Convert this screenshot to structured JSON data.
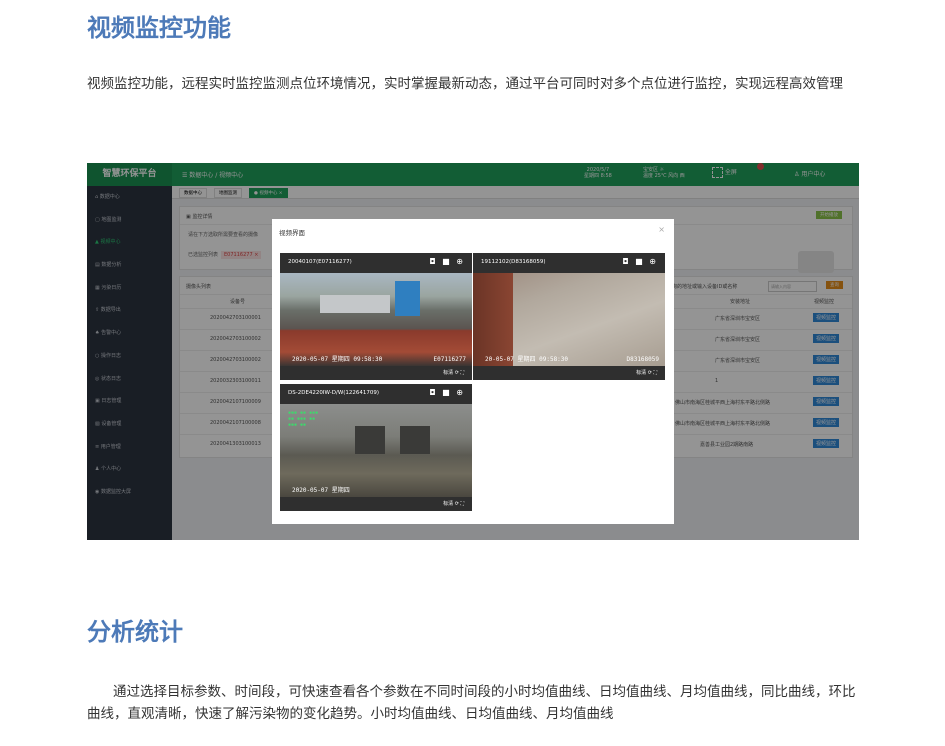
{
  "section1": {
    "title": "视频监控功能",
    "desc": "视频监控功能，远程实时监控监测点位环境情况，实时掌握最新动态，通过平台可同时对多个点位进行监控，实现远程高效管理"
  },
  "section2": {
    "title": "分析统计",
    "desc": "通过选择目标参数、时间段，可快速查看各个参数在不同时间段的小时均值曲线、日均值曲线、月均值曲线，同比曲线，环比曲线，直观清晰，快速了解污染物的变化趋势。小时均值曲线、日均值曲线、月均值曲线"
  },
  "app": {
    "brand": "智慧环保平台",
    "breadcrumb": "数据中心 / 视频中心",
    "date_line1": "2020/5/7",
    "date_line2": "星期四 8:58",
    "weather_line1": "宝安区 ☼",
    "weather_line2": "温度 25℃ 风向 西",
    "fullscreen": "全屏",
    "user": "用户中心",
    "sidebar": [
      {
        "label": "数据中心",
        "icon": "home-icon",
        "active": false
      },
      {
        "label": "地图监测",
        "icon": "map-icon",
        "active": false
      },
      {
        "label": "视频中心",
        "icon": "video-icon",
        "active": true
      },
      {
        "label": "数据分析",
        "icon": "chart-icon",
        "active": false
      },
      {
        "label": "污染日历",
        "icon": "calendar-icon",
        "active": false
      },
      {
        "label": "数据导出",
        "icon": "export-icon",
        "active": false
      },
      {
        "label": "告警中心",
        "icon": "alarm-icon",
        "active": false
      },
      {
        "label": "操作日志",
        "icon": "log-icon",
        "active": false
      },
      {
        "label": "状态日志",
        "icon": "status-icon",
        "active": false
      },
      {
        "label": "日志管理",
        "icon": "manage-icon",
        "active": false
      },
      {
        "label": "设备管理",
        "icon": "device-icon",
        "active": false
      },
      {
        "label": "用户管理",
        "icon": "users-icon",
        "active": false
      },
      {
        "label": "个人中心",
        "icon": "person-icon",
        "active": false
      },
      {
        "label": "数据监控大屏",
        "icon": "screen-icon",
        "active": false
      }
    ],
    "tabs": [
      "数据中心",
      "地图监测",
      "● 视频中心 ×"
    ],
    "panel_title": "监控详情",
    "panel_btn": "开始播放",
    "hint": "请在下方选取所需要查看的摄像",
    "selected_label": "已选监控列表",
    "selected_pill": "E07116277 ×",
    "list_title": "摄像头列表",
    "search_hint": "请选择查询的地址或输入设备ID或名称",
    "search_placeholder": "请输入内容",
    "search_btn": "查询",
    "col_id": "设备号",
    "col_addr": "安装地址",
    "col_op": "视频监控",
    "rows": [
      {
        "id": "2020042703100001",
        "addr": "广东省深圳市宝安区",
        "op": "视频监控"
      },
      {
        "id": "2020042703100002",
        "addr": "广东省深圳市宝安区",
        "op": "视频监控"
      },
      {
        "id": "2020042703100002",
        "addr": "广东省深圳市宝安区",
        "op": "视频监控"
      },
      {
        "id": "2020032303100011",
        "addr": "1",
        "op": "视频监控"
      },
      {
        "id": "2020042107100009",
        "addr": "佛山市南海区桂城平西上海村东平路北侧路",
        "op": "视频监控"
      },
      {
        "id": "2020042107100008",
        "addr": "佛山市南海区桂城平西上海村东平路北侧路",
        "op": "视频监控"
      },
      {
        "id": "2020041303100013",
        "addr": "嘉善县工业园2期路南路",
        "op": "视频监控"
      }
    ]
  },
  "modal": {
    "title": "视频界面",
    "cameras": [
      {
        "name": "20040107(E07116277)",
        "ts": "2020-05-07 星期四 09:58:30",
        "id_overlay": "E07116277",
        "footer": "标清 ⟳ ⛶"
      },
      {
        "name": "19112102(D83168059)",
        "ts": "20-05-07 星期四 09:58:30",
        "id_overlay": "D83168059",
        "footer": "标清 ⟳ ⛶"
      },
      {
        "name": "DS-2DE4220IW-D/W(122641709)",
        "ts": "2020-05-07 星期四",
        "id_overlay": "",
        "footer": "标清 ⟳ ⛶"
      }
    ]
  }
}
